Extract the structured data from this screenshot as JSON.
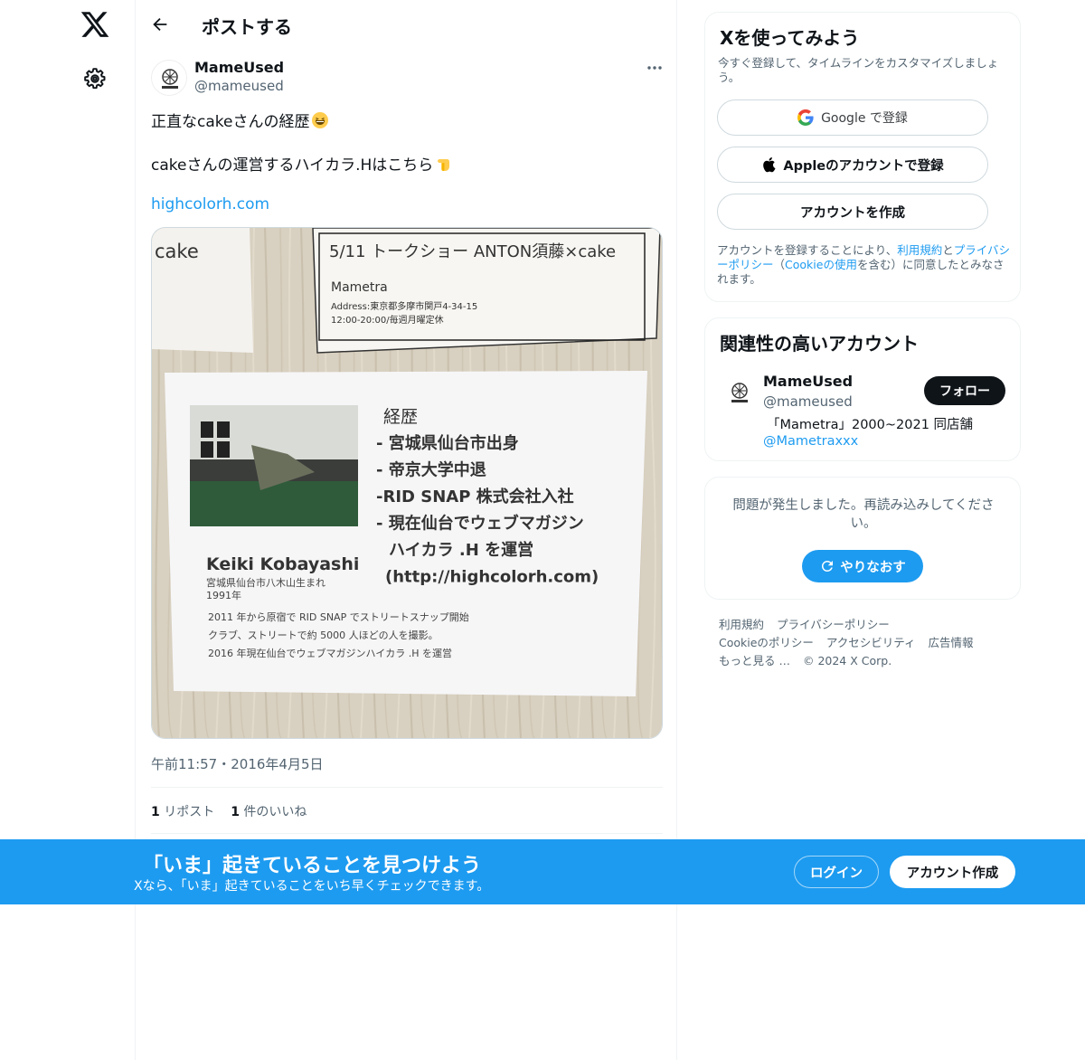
{
  "header": {
    "title": "ポストする"
  },
  "post": {
    "author_name": "MameUsed",
    "author_handle": "@mameused",
    "text_line1": "正直なcakeさんの経歴",
    "text_line2": "cakeさんの運営するハイカラ.Hはこちら",
    "link": "highcolorh.com",
    "timestamp": "午前11:57・2016年4月5日",
    "reposts_count": "1",
    "reposts_label": "リポスト",
    "likes_count": "1",
    "likes_label": "件のいいね",
    "media": {
      "top_left_text": "cake",
      "poster_title": "5/11 トークショー ANTON須藤×cake",
      "poster_venue": "Mametra",
      "poster_address": "Address:東京都多摩市関戸4-34-15",
      "poster_hours": "12:00-20:00/毎週月曜定休",
      "career_heading": "経歴",
      "career_items": [
        "- 宮城県仙台市出身",
        "- 帝京大学中退",
        "-RID SNAP 株式会社入社",
        "- 現在仙台でウェブマガジン",
        "ハイカラ .H を運営",
        "(http://highcolorh.com)"
      ],
      "person_name": "Keiki Kobayashi",
      "person_birthplace": "宮城県仙台市八木山生まれ",
      "person_year": "1991年",
      "history_lines": [
        "2011 年から原宿で RID SNAP でストリートスナップ開始",
        "クラブ、ストリートで約 5000 人ほどの人を撮影。",
        "2016 年現在仙台でウェブマガジンハイカラ .H を運営"
      ]
    }
  },
  "signup_card": {
    "title": "Xを使ってみよう",
    "subtitle": "今すぐ登録して、タイムラインをカスタマイズしましょう。",
    "google_label": "Google で登録",
    "apple_label": "Appleのアカウントで登録",
    "create_label": "アカウントを作成",
    "terms_prefix": "アカウントを登録することにより、",
    "terms_link1": "利用規約",
    "terms_and": "と",
    "terms_link2": "プライバシーポリシー",
    "terms_paren_open": "（",
    "terms_link3": "Cookieの使用",
    "terms_suffix": "を含む）に同意したとみなされます。"
  },
  "related": {
    "title": "関連性の高いアカウント",
    "name": "MameUsed",
    "handle": "@mameused",
    "bio": "「Mametra」2000~2021 同店舗",
    "bio_link": "@Mametraxxx",
    "follow_label": "フォロー"
  },
  "error_card": {
    "message": "問題が発生しました。再読み込みしてください。",
    "retry_label": "やりなおす"
  },
  "footer": {
    "links": [
      "利用規約",
      "プライバシーポリシー",
      "Cookieのポリシー",
      "アクセシビリティ",
      "広告情報",
      "もっと見る …",
      "© 2024 X Corp."
    ]
  },
  "banner": {
    "title": "「いま」起きていることを見つけよう",
    "subtitle": "Xなら、「いま」起きていることをいち早くチェックできます。",
    "login_label": "ログイン",
    "signup_label": "アカウント作成"
  },
  "colors": {
    "accent": "#1d9bf0",
    "text": "#0f1419",
    "muted": "#536471"
  }
}
